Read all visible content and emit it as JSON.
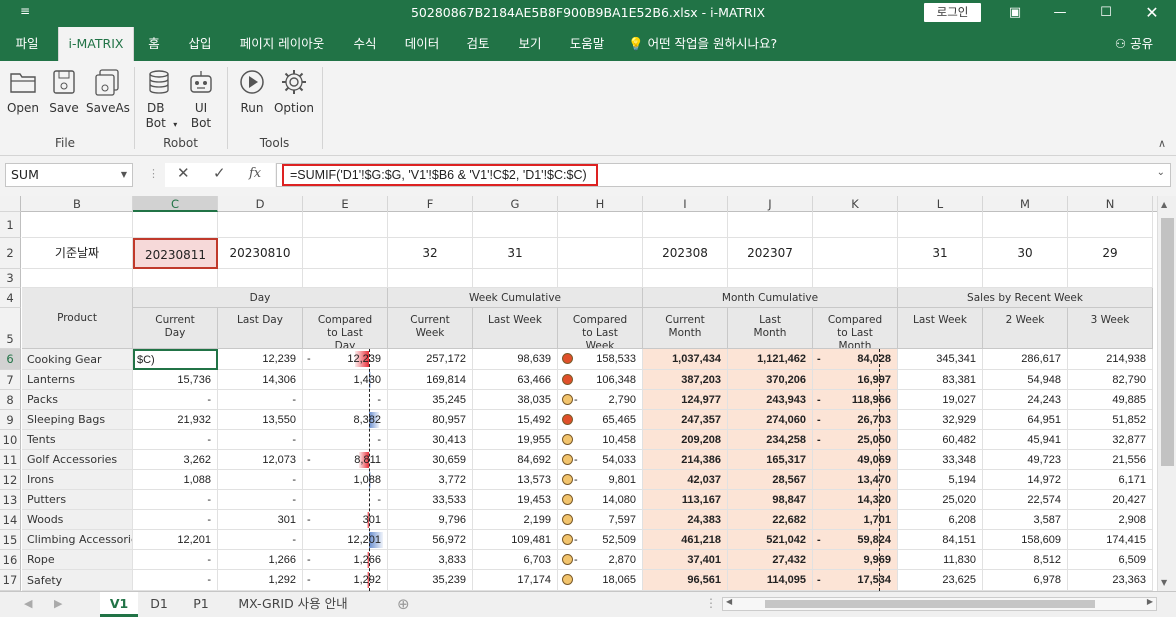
{
  "window": {
    "title": "50280867B2184AE5B8F900B9BA1E52B6.xlsx  -  i-MATRIX",
    "quick_access": "≡",
    "login_label": "로그인"
  },
  "ribbon_tabs": [
    "파일",
    "i-MATRIX",
    "홈",
    "삽입",
    "페이지 레이아웃",
    "수식",
    "데이터",
    "검토",
    "보기",
    "도움말",
    "어떤 작업을 원하시나요?"
  ],
  "share_label": "공유",
  "ribbon": {
    "buttons": [
      "Open",
      "Save",
      "SaveAs",
      "DB Bot",
      "UI Bot",
      "Run",
      "Option"
    ],
    "groups": [
      "File",
      "Robot",
      "Tools"
    ]
  },
  "formula_bar": {
    "name_box": "SUM",
    "formula": "=SUMIF('D1'!$G:$G, 'V1'!$B6 & 'V1'!C$2, 'D1'!$C:$C)"
  },
  "columns": [
    "B",
    "C",
    "D",
    "E",
    "F",
    "G",
    "H",
    "I",
    "J",
    "K",
    "L",
    "M",
    "N"
  ],
  "rows": [
    "1",
    "2",
    "3",
    "4",
    "5",
    "6",
    "7",
    "8",
    "9",
    "10",
    "11",
    "12",
    "13",
    "14",
    "15",
    "16",
    "17"
  ],
  "row2": {
    "label": "기준날짜",
    "C": "20230811",
    "D": "20230810",
    "F": "32",
    "G": "31",
    "I": "202308",
    "J": "202307",
    "L": "31",
    "M": "30",
    "N": "29"
  },
  "header_groups": {
    "product": "Product",
    "day": "Day",
    "week": "Week Cumulative",
    "month": "Month Cumulative",
    "sales": "Sales by Recent Week"
  },
  "header_cols": [
    "Current Day",
    "Last Day",
    "Compared to Last Day",
    "Current Week",
    "Last Week",
    "Compared to Last Week",
    "Current Month",
    "Last Month",
    "Compared to Last Month",
    "Last Week",
    "2 Week",
    "3 Week"
  ],
  "editing_cell": "$C)",
  "table": [
    {
      "product": "Cooking Gear",
      "cd": "",
      "ld": "12,239",
      "cmp_d": "12,239",
      "cmp_d_sign": "-",
      "cw": "257,172",
      "lw": "98,639",
      "cmp_w": "158,533",
      "cmp_w_sign": "",
      "wdot": "red",
      "cm": "1,037,434",
      "lm": "1,121,462",
      "cmp_m": "84,028",
      "cmp_m_sign": "-",
      "w1": "345,341",
      "w2": "286,617",
      "w3": "214,938"
    },
    {
      "product": "Lanterns",
      "cd": "15,736",
      "ld": "14,306",
      "cmp_d": "1,430",
      "cmp_d_sign": "",
      "cw": "169,814",
      "lw": "63,466",
      "cmp_w": "106,348",
      "cmp_w_sign": "",
      "wdot": "red",
      "cm": "387,203",
      "lm": "370,206",
      "cmp_m": "16,997",
      "cmp_m_sign": "",
      "w1": "83,381",
      "w2": "54,948",
      "w3": "82,790"
    },
    {
      "product": "Packs",
      "cd": "-",
      "ld": "-",
      "cmp_d": "-",
      "cmp_d_sign": "",
      "cw": "35,245",
      "lw": "38,035",
      "cmp_w": "2,790",
      "cmp_w_sign": "-",
      "wdot": "yellow",
      "cm": "124,977",
      "lm": "243,943",
      "cmp_m": "118,966",
      "cmp_m_sign": "-",
      "w1": "19,027",
      "w2": "24,243",
      "w3": "49,885"
    },
    {
      "product": "Sleeping Bags",
      "cd": "21,932",
      "ld": "13,550",
      "cmp_d": "8,382",
      "cmp_d_sign": "",
      "cw": "80,957",
      "lw": "15,492",
      "cmp_w": "65,465",
      "cmp_w_sign": "",
      "wdot": "red",
      "cm": "247,357",
      "lm": "274,060",
      "cmp_m": "26,703",
      "cmp_m_sign": "-",
      "w1": "32,929",
      "w2": "64,951",
      "w3": "51,852"
    },
    {
      "product": "Tents",
      "cd": "-",
      "ld": "-",
      "cmp_d": "-",
      "cmp_d_sign": "",
      "cw": "30,413",
      "lw": "19,955",
      "cmp_w": "10,458",
      "cmp_w_sign": "",
      "wdot": "yellow",
      "cm": "209,208",
      "lm": "234,258",
      "cmp_m": "25,050",
      "cmp_m_sign": "-",
      "w1": "60,482",
      "w2": "45,941",
      "w3": "32,877"
    },
    {
      "product": "Golf Accessories",
      "cd": "3,262",
      "ld": "12,073",
      "cmp_d": "8,811",
      "cmp_d_sign": "-",
      "cw": "30,659",
      "lw": "84,692",
      "cmp_w": "54,033",
      "cmp_w_sign": "-",
      "wdot": "yellow",
      "cm": "214,386",
      "lm": "165,317",
      "cmp_m": "49,069",
      "cmp_m_sign": "",
      "w1": "33,348",
      "w2": "49,723",
      "w3": "21,556"
    },
    {
      "product": "Irons",
      "cd": "1,088",
      "ld": "-",
      "cmp_d": "1,088",
      "cmp_d_sign": "",
      "cw": "3,772",
      "lw": "13,573",
      "cmp_w": "9,801",
      "cmp_w_sign": "-",
      "wdot": "yellow",
      "cm": "42,037",
      "lm": "28,567",
      "cmp_m": "13,470",
      "cmp_m_sign": "",
      "w1": "5,194",
      "w2": "14,972",
      "w3": "6,171"
    },
    {
      "product": "Putters",
      "cd": "-",
      "ld": "-",
      "cmp_d": "-",
      "cmp_d_sign": "",
      "cw": "33,533",
      "lw": "19,453",
      "cmp_w": "14,080",
      "cmp_w_sign": "",
      "wdot": "yellow",
      "cm": "113,167",
      "lm": "98,847",
      "cmp_m": "14,320",
      "cmp_m_sign": "",
      "w1": "25,020",
      "w2": "22,574",
      "w3": "20,427"
    },
    {
      "product": "Woods",
      "cd": "-",
      "ld": "301",
      "cmp_d": "301",
      "cmp_d_sign": "-",
      "cw": "9,796",
      "lw": "2,199",
      "cmp_w": "7,597",
      "cmp_w_sign": "",
      "wdot": "yellow",
      "cm": "24,383",
      "lm": "22,682",
      "cmp_m": "1,701",
      "cmp_m_sign": "",
      "w1": "6,208",
      "w2": "3,587",
      "w3": "2,908"
    },
    {
      "product": "Climbing Accessories",
      "cd": "12,201",
      "ld": "-",
      "cmp_d": "12,201",
      "cmp_d_sign": "",
      "cw": "56,972",
      "lw": "109,481",
      "cmp_w": "52,509",
      "cmp_w_sign": "-",
      "wdot": "yellow",
      "cm": "461,218",
      "lm": "521,042",
      "cmp_m": "59,824",
      "cmp_m_sign": "-",
      "w1": "84,151",
      "w2": "158,609",
      "w3": "174,415"
    },
    {
      "product": "Rope",
      "cd": "-",
      "ld": "1,266",
      "cmp_d": "1,266",
      "cmp_d_sign": "-",
      "cw": "3,833",
      "lw": "6,703",
      "cmp_w": "2,870",
      "cmp_w_sign": "-",
      "wdot": "yellow",
      "cm": "37,401",
      "lm": "27,432",
      "cmp_m": "9,969",
      "cmp_m_sign": "",
      "w1": "11,830",
      "w2": "8,512",
      "w3": "6,509"
    },
    {
      "product": "Safety",
      "cd": "-",
      "ld": "1,292",
      "cmp_d": "1,292",
      "cmp_d_sign": "-",
      "cw": "35,239",
      "lw": "17,174",
      "cmp_w": "18,065",
      "cmp_w_sign": "",
      "wdot": "yellow",
      "cm": "96,561",
      "lm": "114,095",
      "cmp_m": "17,534",
      "cmp_m_sign": "-",
      "w1": "23,625",
      "w2": "6,978",
      "w3": "23,363"
    }
  ],
  "day_bars": [
    {
      "row": 0,
      "dir": "neg",
      "frac": 0.8
    },
    {
      "row": 1,
      "dir": "pos",
      "frac": 0.1
    },
    {
      "row": 3,
      "dir": "pos",
      "frac": 0.55
    },
    {
      "row": 5,
      "dir": "neg",
      "frac": 0.58
    },
    {
      "row": 6,
      "dir": "pos",
      "frac": 0.07
    },
    {
      "row": 8,
      "dir": "neg",
      "frac": 0.02
    },
    {
      "row": 9,
      "dir": "pos",
      "frac": 0.8
    },
    {
      "row": 10,
      "dir": "neg",
      "frac": 0.08
    },
    {
      "row": 11,
      "dir": "neg",
      "frac": 0.08
    }
  ],
  "month_bars": [
    {
      "row": 0,
      "dir": "neg",
      "frac": 0.7
    },
    {
      "row": 1,
      "dir": "pos",
      "frac": 0.14
    },
    {
      "row": 2,
      "dir": "neg",
      "frac": 1.0
    },
    {
      "row": 3,
      "dir": "neg",
      "frac": 0.22
    },
    {
      "row": 4,
      "dir": "neg",
      "frac": 0.21
    },
    {
      "row": 5,
      "dir": "pos",
      "frac": 0.41
    },
    {
      "row": 6,
      "dir": "pos",
      "frac": 0.11
    },
    {
      "row": 7,
      "dir": "pos",
      "frac": 0.12
    },
    {
      "row": 8,
      "dir": "pos",
      "frac": 0.01
    },
    {
      "row": 9,
      "dir": "neg",
      "frac": 0.5
    },
    {
      "row": 10,
      "dir": "pos",
      "frac": 0.08
    },
    {
      "row": 11,
      "dir": "neg",
      "frac": 0.15
    }
  ],
  "colors": {
    "accent": "#217346",
    "neg_bar": "#e8303a",
    "pos_bar": "#6a8fd0",
    "pos_bar_month": "#3aa657",
    "dot_red": "#e0502a",
    "dot_yellow": "#f2c46d",
    "peach": "#fce4d6"
  },
  "sheet_tabs": [
    "V1",
    "D1",
    "P1",
    "MX-GRID 사용 안내"
  ]
}
